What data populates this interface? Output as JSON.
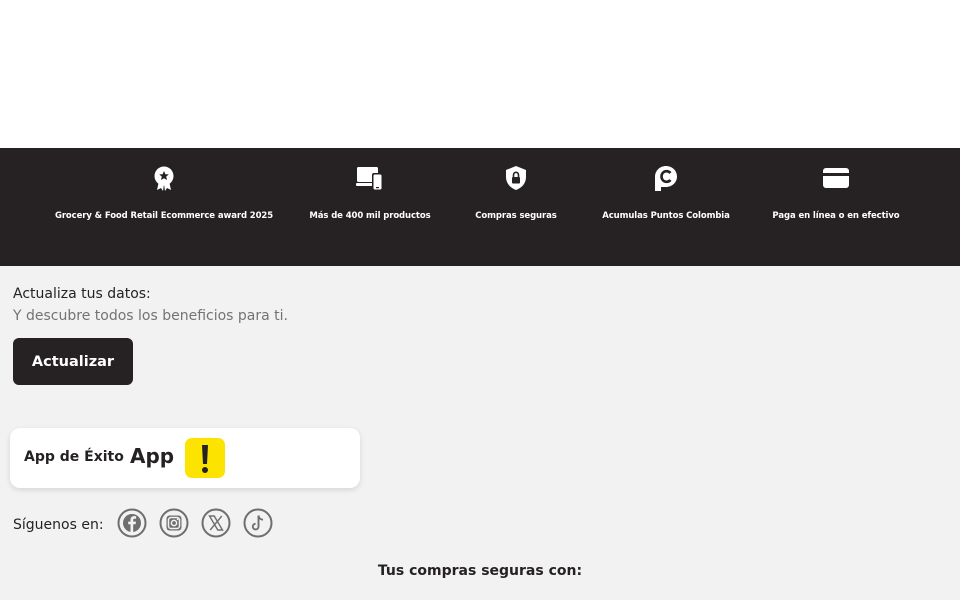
{
  "benefits": [
    {
      "icon": "award-badge-icon",
      "label": "Grocery & Food Retail Ecommerce award 2025"
    },
    {
      "icon": "devices-icon",
      "label": "Más de 400 mil productos"
    },
    {
      "icon": "shield-lock-icon",
      "label": "Compras seguras"
    },
    {
      "icon": "puntos-colombia-icon",
      "label": "Acumulas Puntos Colombia"
    },
    {
      "icon": "credit-card-icon",
      "label": "Paga en línea o en efectivo"
    }
  ],
  "update": {
    "title": "Actualiza tus datos:",
    "subtitle": "Y descubre todos los beneficios para ti.",
    "button_label": "Actualizar"
  },
  "app": {
    "title": "App de Éxito",
    "app_word": "App",
    "logo_icon": "exito-exclamation-icon"
  },
  "social": {
    "label": "Síguenos en:",
    "icons": [
      "facebook-icon",
      "instagram-icon",
      "x-twitter-icon",
      "tiktok-icon"
    ]
  },
  "secure": {
    "title": "Tus compras seguras con:"
  },
  "colors": {
    "dark": "#262223",
    "background": "#f2f2f2",
    "accent_yellow": "#fce400",
    "muted_text": "#737373",
    "social_icon_gray": "#6e6e6e"
  }
}
